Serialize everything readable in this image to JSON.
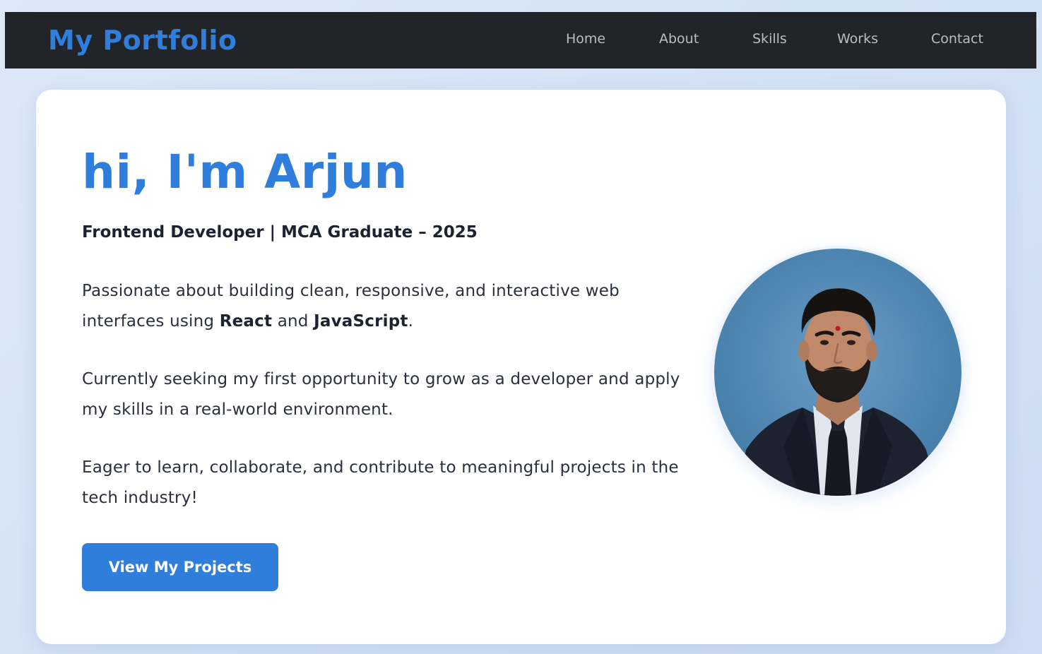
{
  "navbar": {
    "brand": "My Portfolio",
    "links": [
      {
        "label": "Home"
      },
      {
        "label": "About"
      },
      {
        "label": "Skills"
      },
      {
        "label": "Works"
      },
      {
        "label": "Contact"
      }
    ]
  },
  "hero": {
    "title": "hi, I'm Arjun",
    "subtitle": "Frontend Developer | MCA Graduate – 2025",
    "para1": {
      "before": "Passionate about building clean, responsive, and interactive web interfaces using ",
      "bold1": "React",
      "middle": " and ",
      "bold2": "JavaScript",
      "after": "."
    },
    "para2": "Currently seeking my first opportunity to grow as a developer and apply my skills in a real-world environment.",
    "para3": "Eager to learn, collaborate, and contribute to meaningful projects in the tech industry!",
    "cta_label": "View My Projects",
    "avatar_icon": "profile-photo"
  },
  "colors": {
    "accent": "#2f7edc",
    "navbar_bg": "#212529",
    "nav_link": "#b9bec5",
    "text_dark": "#1d2230"
  }
}
